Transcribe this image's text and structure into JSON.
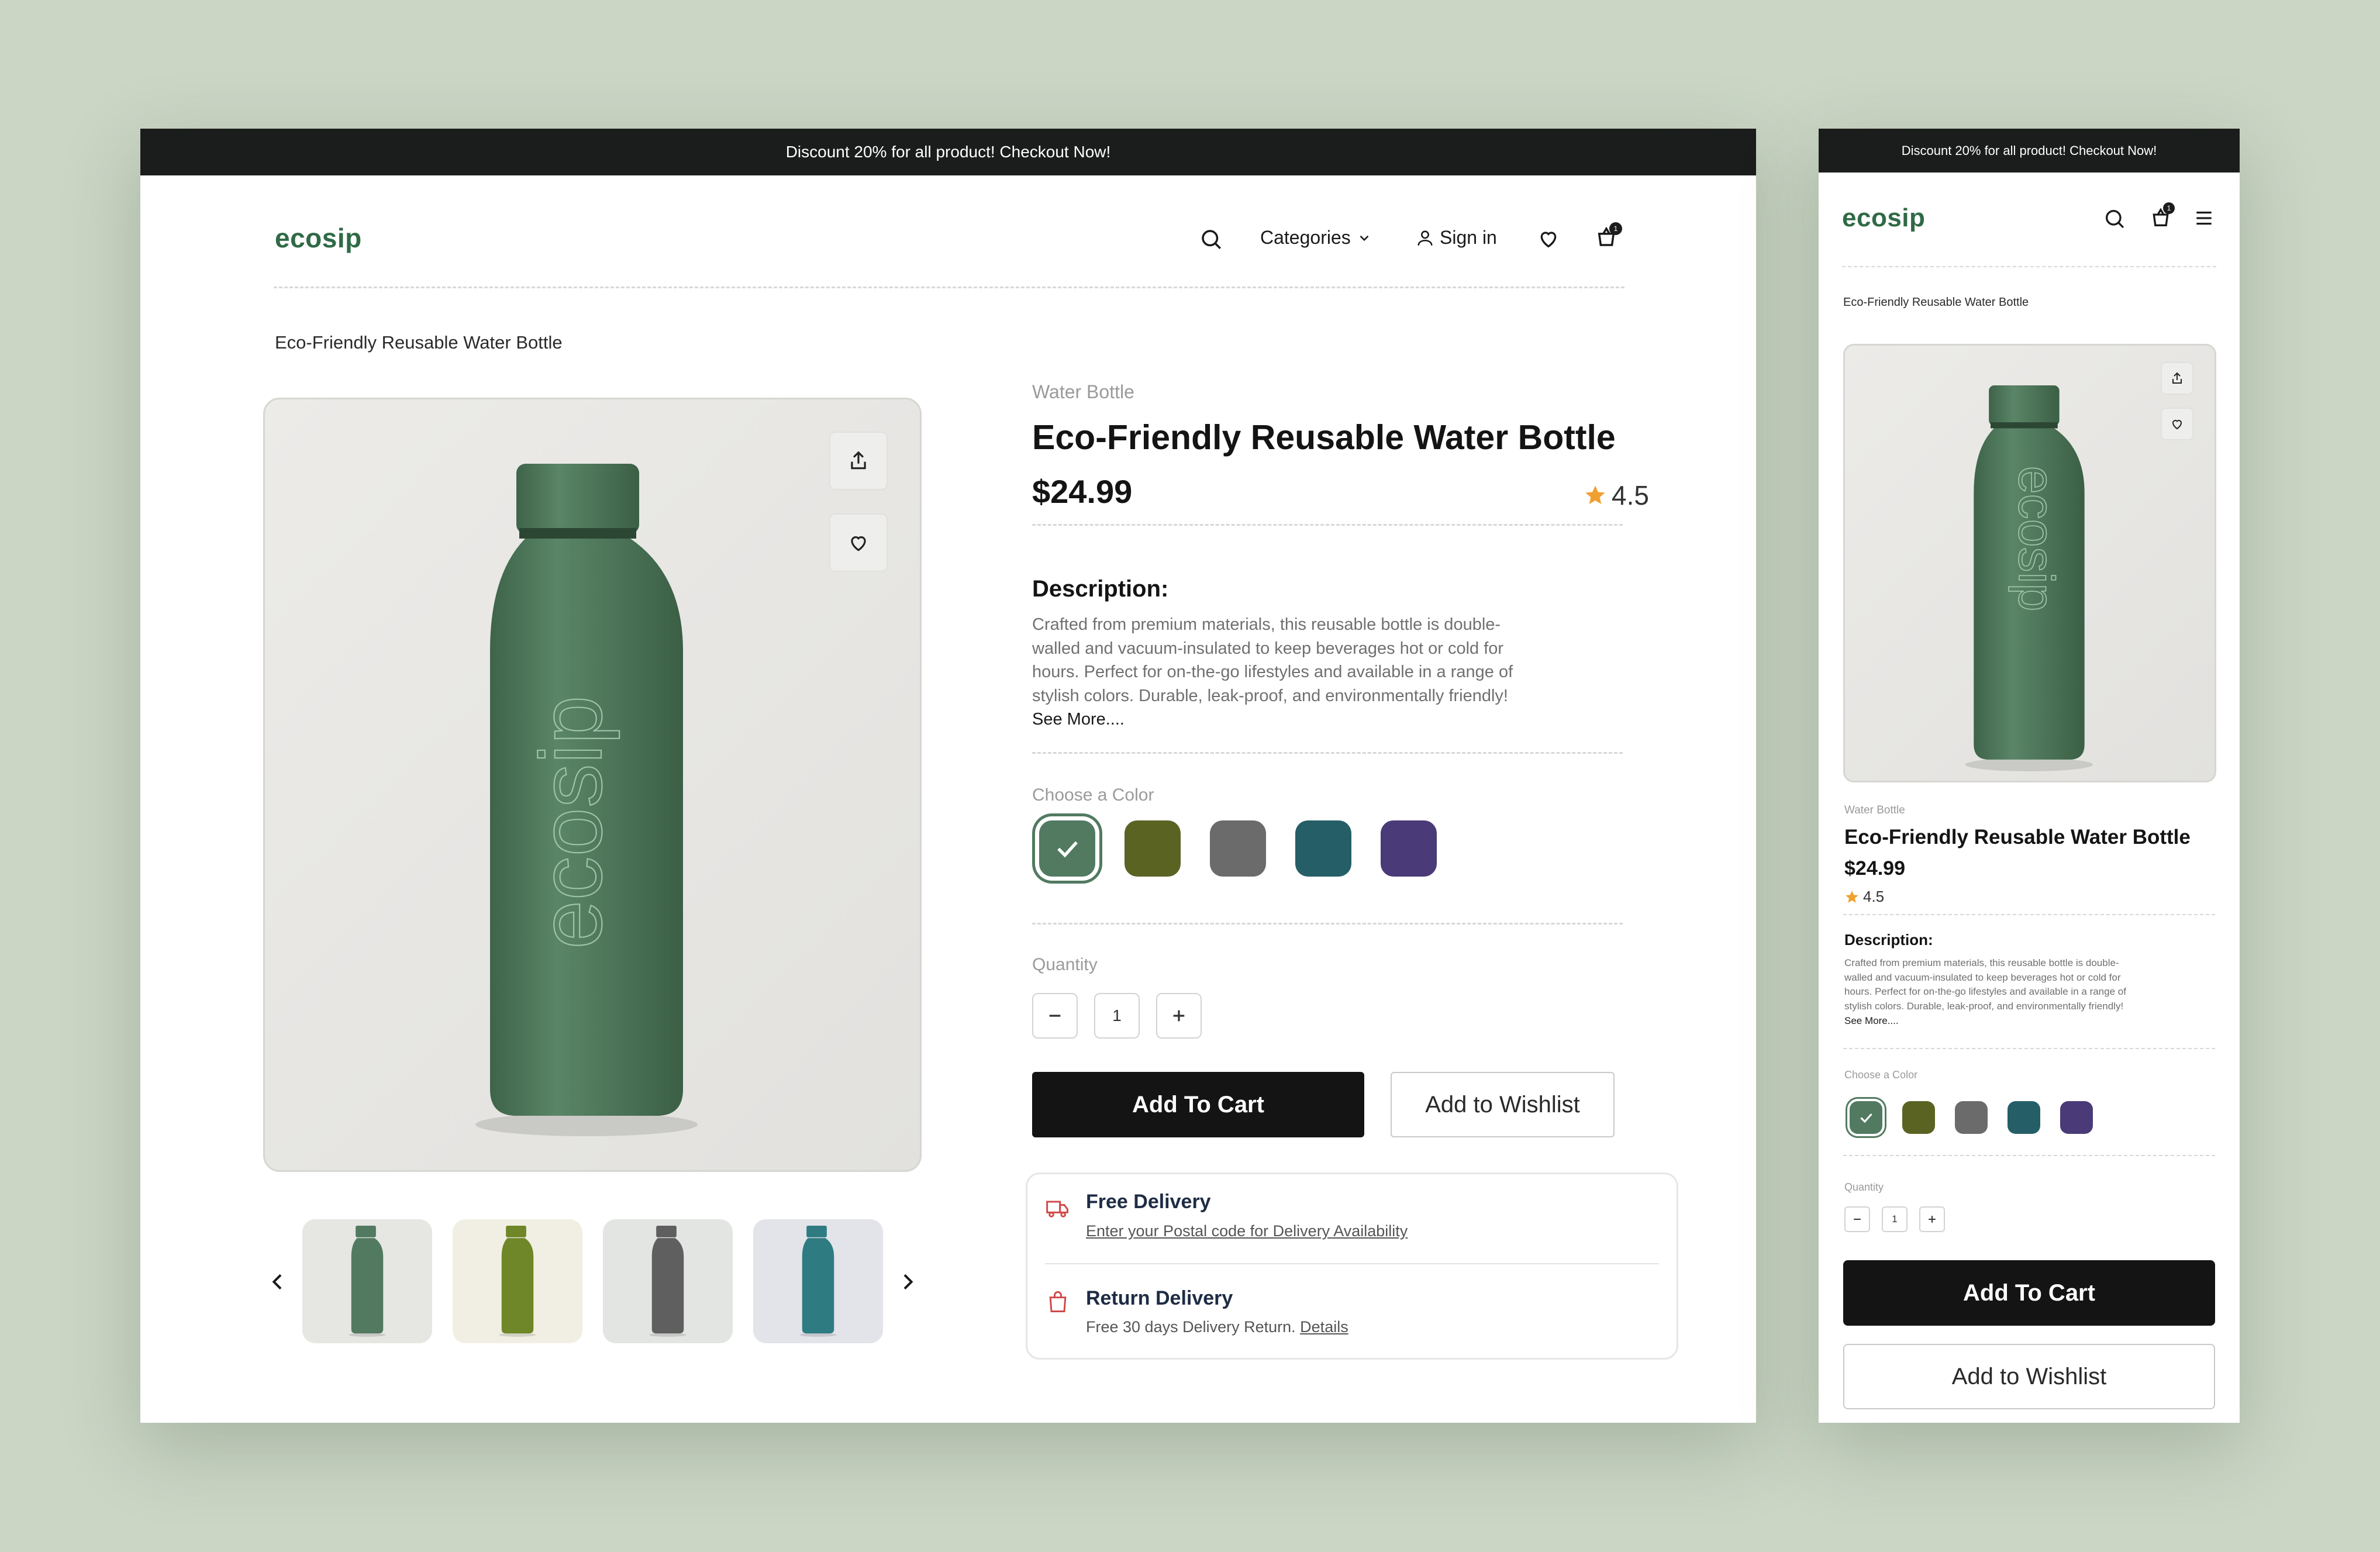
{
  "promo_banner": "Discount 20% for all product!  Checkout Now!",
  "brand": {
    "logo_text": "ecosip"
  },
  "nav": {
    "categories_label": "Categories",
    "sign_in_label": "Sign in",
    "cart_count": "1"
  },
  "breadcrumb": "Eco-Friendly Reusable Water Bottle",
  "product": {
    "category": "Water Bottle",
    "title": "Eco-Friendly Reusable Water Bottle",
    "price": "$24.99",
    "rating": "4.5",
    "bottle_print": "ecosip",
    "description_heading": "Description:",
    "description_lines": [
      "Crafted from premium materials, this reusable bottle is double-",
      "walled and vacuum-insulated to keep beverages hot or cold for",
      "hours. Perfect for on-the-go lifestyles and available in a range of",
      "stylish colors. Durable, leak-proof, and environmentally friendly!"
    ],
    "see_more": "See More....",
    "color_label": "Choose a Color",
    "colors": [
      "#527a61",
      "#5a6322",
      "#6b6b6b",
      "#255e66",
      "#4a3a78"
    ],
    "selected_color_index": 0,
    "quantity_label": "Quantity",
    "quantity": "1",
    "add_to_cart": "Add To Cart",
    "add_to_wishlist": "Add to Wishlist"
  },
  "thumbnails": [
    {
      "bg": "#e6e6e3",
      "bottle": "#527a61"
    },
    {
      "bg": "#f1efe3",
      "bottle": "#6f8728"
    },
    {
      "bg": "#e3e5e3",
      "bottle": "#5f5f5f"
    },
    {
      "bg": "#e3e3ea",
      "bottle": "#2e7c82"
    }
  ],
  "delivery": {
    "free_title": "Free Delivery",
    "free_sub": "Enter your Postal code for Delivery Availability",
    "return_title": "Return Delivery",
    "return_sub": "Free 30 days Delivery Return.",
    "return_link": "Details"
  },
  "colors": {
    "brand_green": "#2f6a46",
    "bottle_green": "#4f7a5c",
    "dark": "#141414",
    "star": "#f0a030",
    "delivery_icon": "#d04848"
  }
}
